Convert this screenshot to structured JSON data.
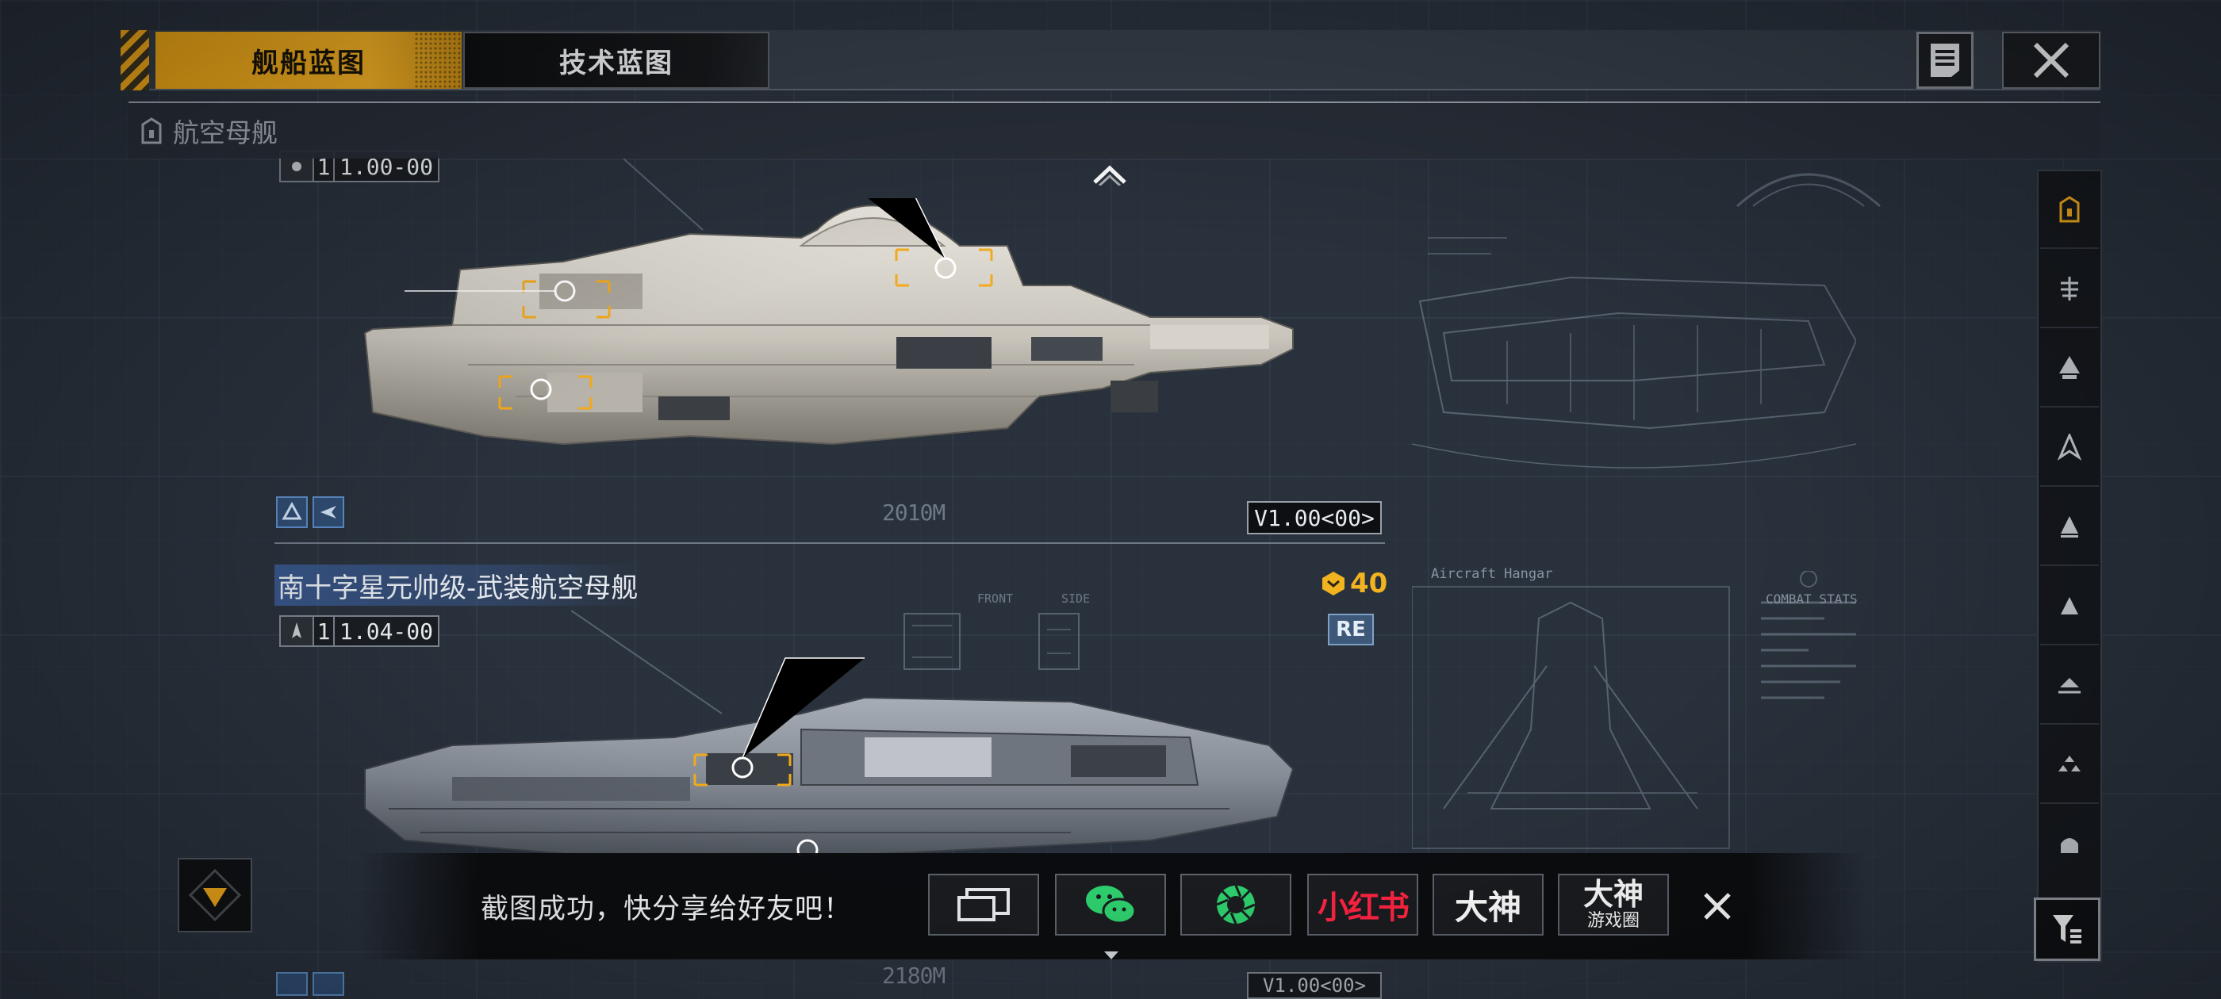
{
  "tabs": {
    "ship_blueprint": "舰船蓝图",
    "tech_blueprint": "技术蓝图"
  },
  "category": {
    "label": "航空母舰",
    "icon": "carrier-icon"
  },
  "upper_ship": {
    "code_prefix": "1",
    "code_value": "1.00-00",
    "version": "V1.00<00>",
    "scale": "2010M"
  },
  "lower_ship": {
    "name": "南十字星元帅级-武装航空母舰",
    "code_prefix": "1",
    "code_value": "1.04-00",
    "cost": "40",
    "badge": "RE",
    "scale": "2180M",
    "version": "V1.00<00>"
  },
  "blueprint_text": {
    "aircraft_hangar": "Aircraft Hangar",
    "combat_stats": "COMBAT STATS",
    "front": "FRONT",
    "side": "SIDE"
  },
  "toast": {
    "message": "截图成功，快分享给好友吧！",
    "share_xiaohongshu": "小红书",
    "share_dashen": "大神",
    "share_dashen_circle_top": "大神",
    "share_dashen_circle_bottom": "游戏圈"
  },
  "sidebar": {
    "items": [
      "carrier-icon",
      "cruiser-icon",
      "destroyer-icon",
      "frigate-icon",
      "corvette-icon",
      "fighter-icon",
      "sub-icon",
      "squad-icon",
      "module-icon"
    ]
  },
  "colors": {
    "accent": "#f2a91a",
    "background": "#29313c",
    "toast_bg": "#0a0b0d",
    "xiaohongshu_red": "#ff2442",
    "wechat_green": "#2ed06e"
  }
}
